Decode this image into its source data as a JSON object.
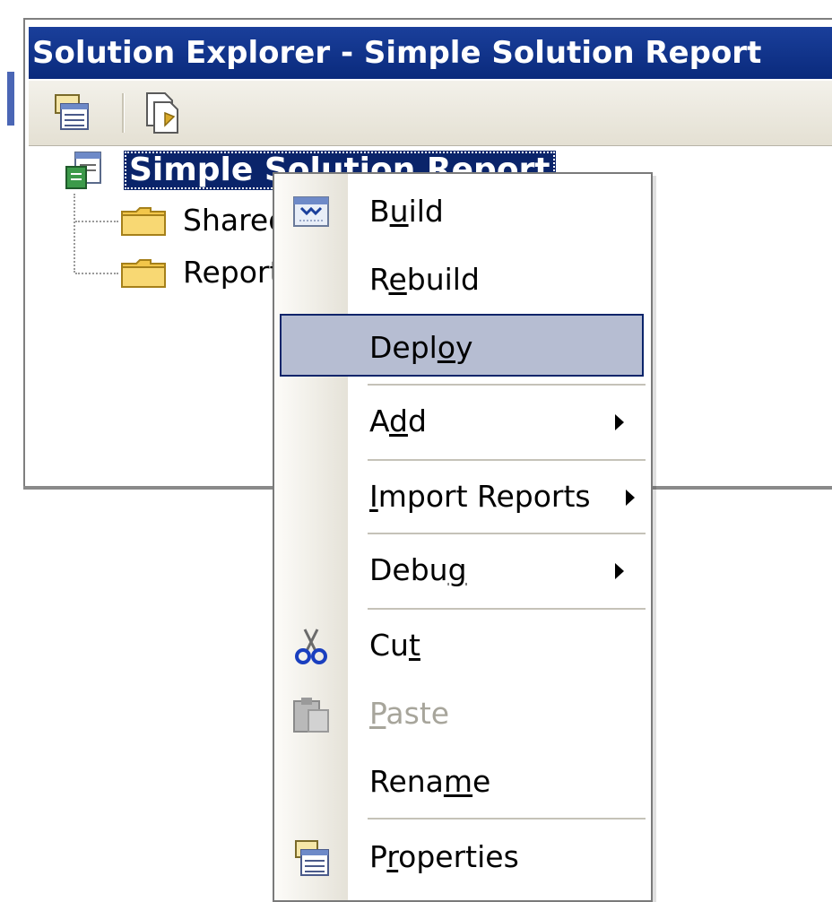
{
  "window": {
    "title": "Solution Explorer - Simple Solution Report"
  },
  "toolbar": {
    "buttons": [
      {
        "icon": "properties-icon"
      },
      {
        "icon": "show-all-files-icon"
      }
    ]
  },
  "tree": {
    "root": {
      "label": "Simple Solution Report",
      "icon": "solution-icon"
    },
    "children": [
      {
        "label": "Shared Data Sources",
        "icon": "folder-icon"
      },
      {
        "label": "Reports",
        "icon": "folder-icon"
      }
    ]
  },
  "context_menu": {
    "items": [
      {
        "pre": "B",
        "key": "u",
        "post": "ild",
        "icon": "build-icon"
      },
      {
        "pre": "R",
        "key": "e",
        "post": "build"
      },
      {
        "pre": "Depl",
        "key": "o",
        "post": "y",
        "highlighted": true
      },
      {
        "pre": "A",
        "key": "d",
        "post": "d",
        "submenu": true
      },
      {
        "pre": "",
        "key": "I",
        "post": "mport Reports",
        "submenu": true
      },
      {
        "pre": "Debu",
        "key": "g",
        "post": "",
        "submenu": true
      },
      {
        "pre": "Cu",
        "key": "t",
        "post": "",
        "icon": "cut-icon"
      },
      {
        "pre": "",
        "key": "P",
        "post": "aste",
        "icon": "paste-icon",
        "disabled": true
      },
      {
        "pre": "Rena",
        "key": "m",
        "post": "e"
      },
      {
        "pre": "P",
        "key": "r",
        "post": "operties",
        "icon": "properties-icon"
      }
    ]
  },
  "colors": {
    "title_bar": "#0a246a",
    "selection": "#0a246a",
    "menu_highlight": "#b6bdd2",
    "disabled_text": "#a7a59b"
  }
}
